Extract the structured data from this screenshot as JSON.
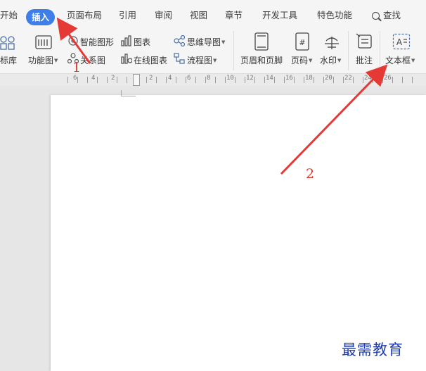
{
  "menubar": {
    "tabs": [
      "开始",
      "插入",
      "页面布局",
      "引用",
      "审阅",
      "视图",
      "章节",
      "开发工具",
      "特色功能"
    ],
    "active_tab": "插入",
    "search_label": "查找"
  },
  "ribbon": {
    "icon_library_label": "标库",
    "function_chart_label": "功能图",
    "smart_graphic_label": "智能图形",
    "chart_label": "图表",
    "mind_map_label": "思维导图",
    "relationship_chart_label": "关系图",
    "online_chart_label": "在线图表",
    "flowchart_label": "流程图",
    "header_footer_label": "页眉和页脚",
    "page_number_label": "页码",
    "page_number_icon": "#",
    "watermark_label": "水印",
    "comment_label": "批注",
    "textbox_label": "文本框",
    "textbox_icon": "A"
  },
  "ruler": {
    "labels": [
      "6",
      "4",
      "2",
      "2",
      "4",
      "6",
      "8",
      "10",
      "12",
      "14",
      "16",
      "18",
      "20",
      "22",
      "24",
      "26"
    ]
  },
  "annotations": {
    "label_1": "1",
    "label_2": "2",
    "arrow_color": "#e53935"
  },
  "watermark": "最需教育",
  "colors": {
    "accent": "#3d7ee8",
    "annotation": "#d93a2e",
    "watermark": "#1f3db0"
  }
}
